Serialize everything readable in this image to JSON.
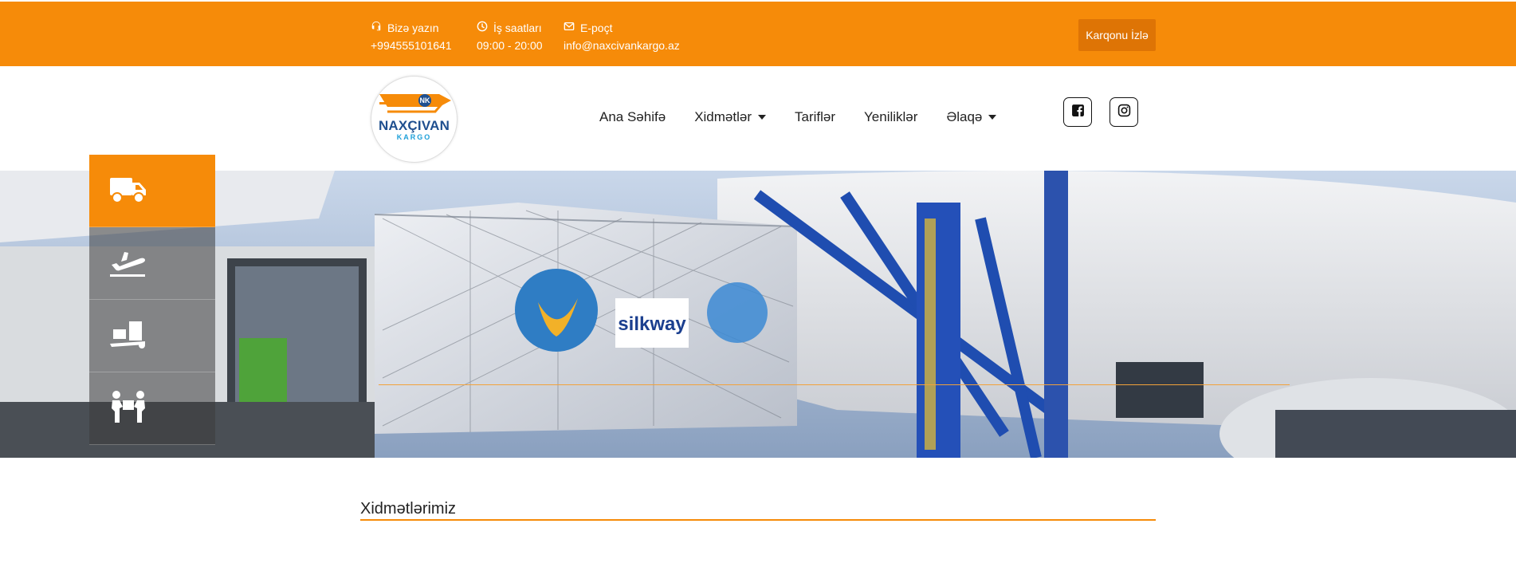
{
  "topbar": {
    "contacts": [
      {
        "icon": "headset-icon",
        "label": "Bizə yazın",
        "value": "+994555101641"
      },
      {
        "icon": "clock-icon",
        "label": "İş saatları",
        "value": "09:00 - 20:00"
      },
      {
        "icon": "envelope-icon",
        "label": "E-poçt",
        "value": "info@naxcivankargo.az"
      }
    ],
    "track_label": "Karqonu İzlə"
  },
  "logo": {
    "text": "NAXÇIVAN",
    "sub": "KARGO",
    "badge": "NK"
  },
  "nav": {
    "items": [
      {
        "label": "Ana Səhifə",
        "dropdown": false
      },
      {
        "label": "Xidmətlər",
        "dropdown": true
      },
      {
        "label": "Tariflər",
        "dropdown": false
      },
      {
        "label": "Yeniliklər",
        "dropdown": false
      },
      {
        "label": "Əlaqə",
        "dropdown": true
      }
    ]
  },
  "social": [
    "facebook-icon",
    "instagram-icon"
  ],
  "sidebar": {
    "items": [
      {
        "icon": "truck-icon",
        "active": true
      },
      {
        "icon": "plane-departure-icon",
        "active": false
      },
      {
        "icon": "dolly-boxes-icon",
        "active": false
      },
      {
        "icon": "people-carry-icon",
        "active": false
      }
    ]
  },
  "hero": {
    "banner_texts": [
      "silkway"
    ]
  },
  "section": {
    "title": "Xidmətlərimiz"
  },
  "colors": {
    "brand_orange": "#f68b09",
    "button_dark_orange": "#de7405",
    "logo_blue": "#1f4f8f"
  }
}
